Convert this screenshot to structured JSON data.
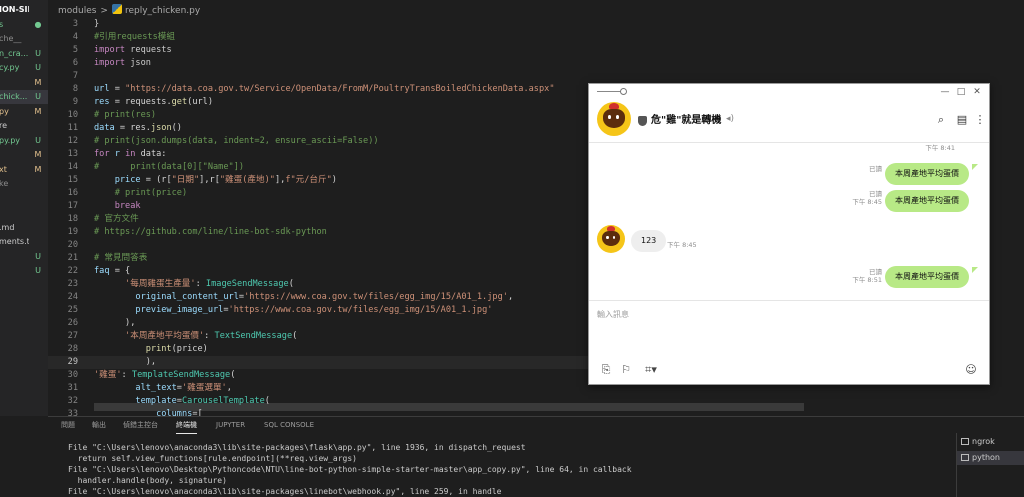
{
  "explorer": {
    "rows": [
      {
        "name": "ION-SIMPL...",
        "badge": "",
        "badge_color": "#cccccc",
        "name_color": "#ffffff",
        "bold": true
      },
      {
        "name": "s",
        "badge": "●",
        "badge_color": "#73c991",
        "name_color": "#73c991",
        "bold": false
      },
      {
        "name": "che__",
        "badge": "",
        "badge_color": "#cccccc",
        "name_color": "#8c8c8c",
        "bold": false
      },
      {
        "name": "n_cra...",
        "badge": "U",
        "badge_color": "#73c991",
        "name_color": "#73c991",
        "bold": false
      },
      {
        "name": "cy.py",
        "badge": "U",
        "badge_color": "#73c991",
        "name_color": "#73c991",
        "bold": false
      },
      {
        "name": "",
        "badge": "M",
        "badge_color": "#e2c08d",
        "name_color": "#e2c08d",
        "bold": false
      },
      {
        "name": "chick...",
        "badge": "U",
        "badge_color": "#73c991",
        "name_color": "#73c991",
        "bold": false
      },
      {
        "name": "py",
        "badge": "M",
        "badge_color": "#e2c08d",
        "name_color": "#e2c08d",
        "bold": false
      },
      {
        "name": "re",
        "badge": "",
        "badge_color": "#cccccc",
        "name_color": "#cccccc",
        "bold": false
      },
      {
        "name": "py.py",
        "badge": "U",
        "badge_color": "#73c991",
        "name_color": "#73c991",
        "bold": false
      },
      {
        "name": "",
        "badge": "M",
        "badge_color": "#e2c08d",
        "name_color": "#e2c08d",
        "bold": false
      },
      {
        "name": "xt",
        "badge": "M",
        "badge_color": "#e2c08d",
        "name_color": "#e2c08d",
        "bold": false
      },
      {
        "name": "ke",
        "badge": "",
        "badge_color": "#cccccc",
        "name_color": "#8c8c8c",
        "bold": false
      },
      {
        "name": "",
        "badge": "",
        "badge_color": "#cccccc",
        "name_color": "#cccccc",
        "bold": false
      },
      {
        "name": "",
        "badge": "",
        "badge_color": "#cccccc",
        "name_color": "#cccccc",
        "bold": false
      },
      {
        "name": ".md",
        "badge": "",
        "badge_color": "#cccccc",
        "name_color": "#cccccc",
        "bold": false
      },
      {
        "name": "ments.txt",
        "badge": "",
        "badge_color": "#cccccc",
        "name_color": "#cccccc",
        "bold": false
      },
      {
        "name": "",
        "badge": "U",
        "badge_color": "#73c991",
        "name_color": "#73c991",
        "bold": false
      },
      {
        "name": "",
        "badge": "U",
        "badge_color": "#73c991",
        "name_color": "#73c991",
        "bold": false
      }
    ]
  },
  "breadcrumb": {
    "folder": "modules",
    "separator": ">",
    "file": "reply_chicken.py"
  },
  "code": [
    {
      "n": "3",
      "parts": [
        [
          "}",
          "#cccccc"
        ]
      ]
    },
    {
      "n": "4",
      "parts": [
        [
          "#引用requests模組",
          "#6a9955"
        ]
      ]
    },
    {
      "n": "5",
      "parts": [
        [
          "import",
          "#c586c0"
        ],
        [
          " requests",
          "#cccccc"
        ]
      ]
    },
    {
      "n": "6",
      "parts": [
        [
          "import",
          "#c586c0"
        ],
        [
          " json",
          "#cccccc"
        ]
      ]
    },
    {
      "n": "7",
      "parts": []
    },
    {
      "n": "8",
      "parts": [
        [
          "url",
          "#9cdcfe"
        ],
        [
          " = ",
          "#d4d4d4"
        ],
        [
          "\"https://data.coa.gov.tw/Service/OpenData/FromM/PoultryTransBoiledChickenData.aspx\"",
          "#ce9178"
        ]
      ]
    },
    {
      "n": "9",
      "parts": [
        [
          "res",
          "#9cdcfe"
        ],
        [
          " = requests.",
          "#d4d4d4"
        ],
        [
          "get",
          "#dcdcaa"
        ],
        [
          "(url)",
          "#d4d4d4"
        ]
      ]
    },
    {
      "n": "10",
      "parts": [
        [
          "# print(res)",
          "#6a9955"
        ]
      ]
    },
    {
      "n": "11",
      "parts": [
        [
          "data",
          "#9cdcfe"
        ],
        [
          " = res.",
          "#d4d4d4"
        ],
        [
          "json",
          "#dcdcaa"
        ],
        [
          "()",
          "#d4d4d4"
        ]
      ]
    },
    {
      "n": "12",
      "parts": [
        [
          "# print(json.dumps(data, indent=2, ensure_ascii=False))",
          "#6a9955"
        ]
      ]
    },
    {
      "n": "13",
      "parts": [
        [
          "for",
          "#c586c0"
        ],
        [
          " r ",
          "#9cdcfe"
        ],
        [
          "in",
          "#c586c0"
        ],
        [
          " data:",
          "#d4d4d4"
        ]
      ]
    },
    {
      "n": "14",
      "parts": [
        [
          "#      print(data[0][\"Name\"])",
          "#6a9955"
        ]
      ]
    },
    {
      "n": "15",
      "parts": [
        [
          "    price",
          "#9cdcfe"
        ],
        [
          " = (r[",
          "#d4d4d4"
        ],
        [
          "\"日期\"",
          "#ce9178"
        ],
        [
          "],r[",
          "#d4d4d4"
        ],
        [
          "\"雞蛋(產地)\"",
          "#ce9178"
        ],
        [
          "],",
          "#d4d4d4"
        ],
        [
          "f\"元/台斤\"",
          "#ce9178"
        ],
        [
          ")",
          "#d4d4d4"
        ]
      ]
    },
    {
      "n": "16",
      "parts": [
        [
          "    # print(price)",
          "#6a9955"
        ]
      ]
    },
    {
      "n": "17",
      "parts": [
        [
          "    break",
          "#c586c0"
        ]
      ]
    },
    {
      "n": "18",
      "parts": [
        [
          "# 官方文件",
          "#6a9955"
        ]
      ]
    },
    {
      "n": "19",
      "parts": [
        [
          "# ",
          "#6a9955"
        ],
        [
          "https://github.com/line/line-bot-sdk-python",
          "#6a9955"
        ]
      ]
    },
    {
      "n": "20",
      "parts": []
    },
    {
      "n": "21",
      "parts": [
        [
          "# 常見問答表",
          "#6a9955"
        ]
      ]
    },
    {
      "n": "22",
      "parts": [
        [
          "faq",
          "#9cdcfe"
        ],
        [
          " = {",
          "#d4d4d4"
        ]
      ]
    },
    {
      "n": "23",
      "parts": [
        [
          "      ",
          "#d4d4d4"
        ],
        [
          "'每周雞蛋生產量'",
          "#ce9178"
        ],
        [
          ": ",
          "#d4d4d4"
        ],
        [
          "ImageSendMessage",
          "#4ec9b0"
        ],
        [
          "(",
          "#d4d4d4"
        ]
      ]
    },
    {
      "n": "24",
      "parts": [
        [
          "        original_content_url",
          "#9cdcfe"
        ],
        [
          "=",
          "#d4d4d4"
        ],
        [
          "'https://www.coa.gov.tw/files/egg_img/15/A01_1.jpg'",
          "#ce9178"
        ],
        [
          ",",
          "#d4d4d4"
        ]
      ]
    },
    {
      "n": "25",
      "parts": [
        [
          "        preview_image_url",
          "#9cdcfe"
        ],
        [
          "=",
          "#d4d4d4"
        ],
        [
          "'https://www.coa.gov.tw/files/egg_img/15/A01_1.jpg'",
          "#ce9178"
        ]
      ]
    },
    {
      "n": "26",
      "parts": [
        [
          "      ),",
          "#d4d4d4"
        ]
      ]
    },
    {
      "n": "27",
      "parts": [
        [
          "      ",
          "#d4d4d4"
        ],
        [
          "'本周產地平均蛋價'",
          "#ce9178"
        ],
        [
          ": ",
          "#d4d4d4"
        ],
        [
          "TextSendMessage",
          "#4ec9b0"
        ],
        [
          "(",
          "#d4d4d4"
        ]
      ]
    },
    {
      "n": "28",
      "parts": [
        [
          "          print",
          "#dcdcaa"
        ],
        [
          "(price)",
          "#d4d4d4"
        ]
      ]
    },
    {
      "n": "29",
      "parts": [
        [
          "          ),",
          "#d4d4d4"
        ]
      ]
    },
    {
      "n": "30",
      "parts": [
        [
          "'雞蛋'",
          "#ce9178"
        ],
        [
          ": ",
          "#d4d4d4"
        ],
        [
          "TemplateSendMessage",
          "#4ec9b0"
        ],
        [
          "(",
          "#d4d4d4"
        ]
      ]
    },
    {
      "n": "31",
      "parts": [
        [
          "        alt_text",
          "#9cdcfe"
        ],
        [
          "=",
          "#d4d4d4"
        ],
        [
          "'雞蛋選單'",
          "#ce9178"
        ],
        [
          ",",
          "#d4d4d4"
        ]
      ]
    },
    {
      "n": "32",
      "parts": [
        [
          "        template",
          "#9cdcfe"
        ],
        [
          "=",
          "#d4d4d4"
        ],
        [
          "CarouselTemplate",
          "#4ec9b0"
        ],
        [
          "(",
          "#d4d4d4"
        ]
      ]
    },
    {
      "n": "33",
      "parts": [
        [
          "            columns",
          "#9cdcfe"
        ],
        [
          "=[",
          "#d4d4d4"
        ]
      ]
    }
  ],
  "current_line": "29",
  "panel": {
    "tabs": [
      "問題",
      "輸出",
      "偵錯主控台",
      "終端機",
      "JUPYTER",
      "SQL CONSOLE"
    ],
    "active_tab": 3,
    "terminal_lines": [
      "File \"C:\\Users\\lenovo\\anaconda3\\lib\\site-packages\\flask\\app.py\", line 1936, in dispatch_request",
      "  return self.view_functions[rule.endpoint](**req.view_args)",
      "File \"C:\\Users\\lenovo\\Desktop\\Pythoncode\\NTU\\line-bot-python-simple-starter-master\\app_copy.py\", line 64, in callback",
      "  handler.handle(body, signature)",
      "File \"C:\\Users\\lenovo\\anaconda3\\lib\\site-packages\\linebot\\webhook.py\", line 259, in handle"
    ],
    "terminals": [
      {
        "label": "ngrok",
        "icon": "terminal-icon"
      },
      {
        "label": "python",
        "icon": "terminal-icon"
      }
    ],
    "active_terminal": 1
  },
  "line_chat": {
    "window_buttons": {
      "minimize": "—",
      "maximize": "□",
      "close": "✕"
    },
    "chat_name": "危\"雞\"就是轉機",
    "header_icons": [
      "search-icon",
      "notes-icon",
      "more-icon"
    ],
    "messages": [
      {
        "dir": "system",
        "time": "下午 8:41"
      },
      {
        "dir": "out",
        "text": "本周產地平均蛋價",
        "read": "已讀",
        "time": ""
      },
      {
        "dir": "out",
        "text": "本周產地平均蛋價",
        "read": "已讀",
        "time": "下午 8:45"
      },
      {
        "dir": "in",
        "text": "123",
        "time": "下午 8:45"
      },
      {
        "dir": "out",
        "text": "本周產地平均蛋價",
        "read": "已讀",
        "time": "下午 8:51"
      }
    ],
    "input_placeholder": "輸入訊息",
    "input_value": "",
    "toolbar_icons": [
      "attach-icon",
      "bookmark-icon",
      "crop-icon",
      "emoji-icon"
    ],
    "bubble_color": "#b8e986"
  }
}
